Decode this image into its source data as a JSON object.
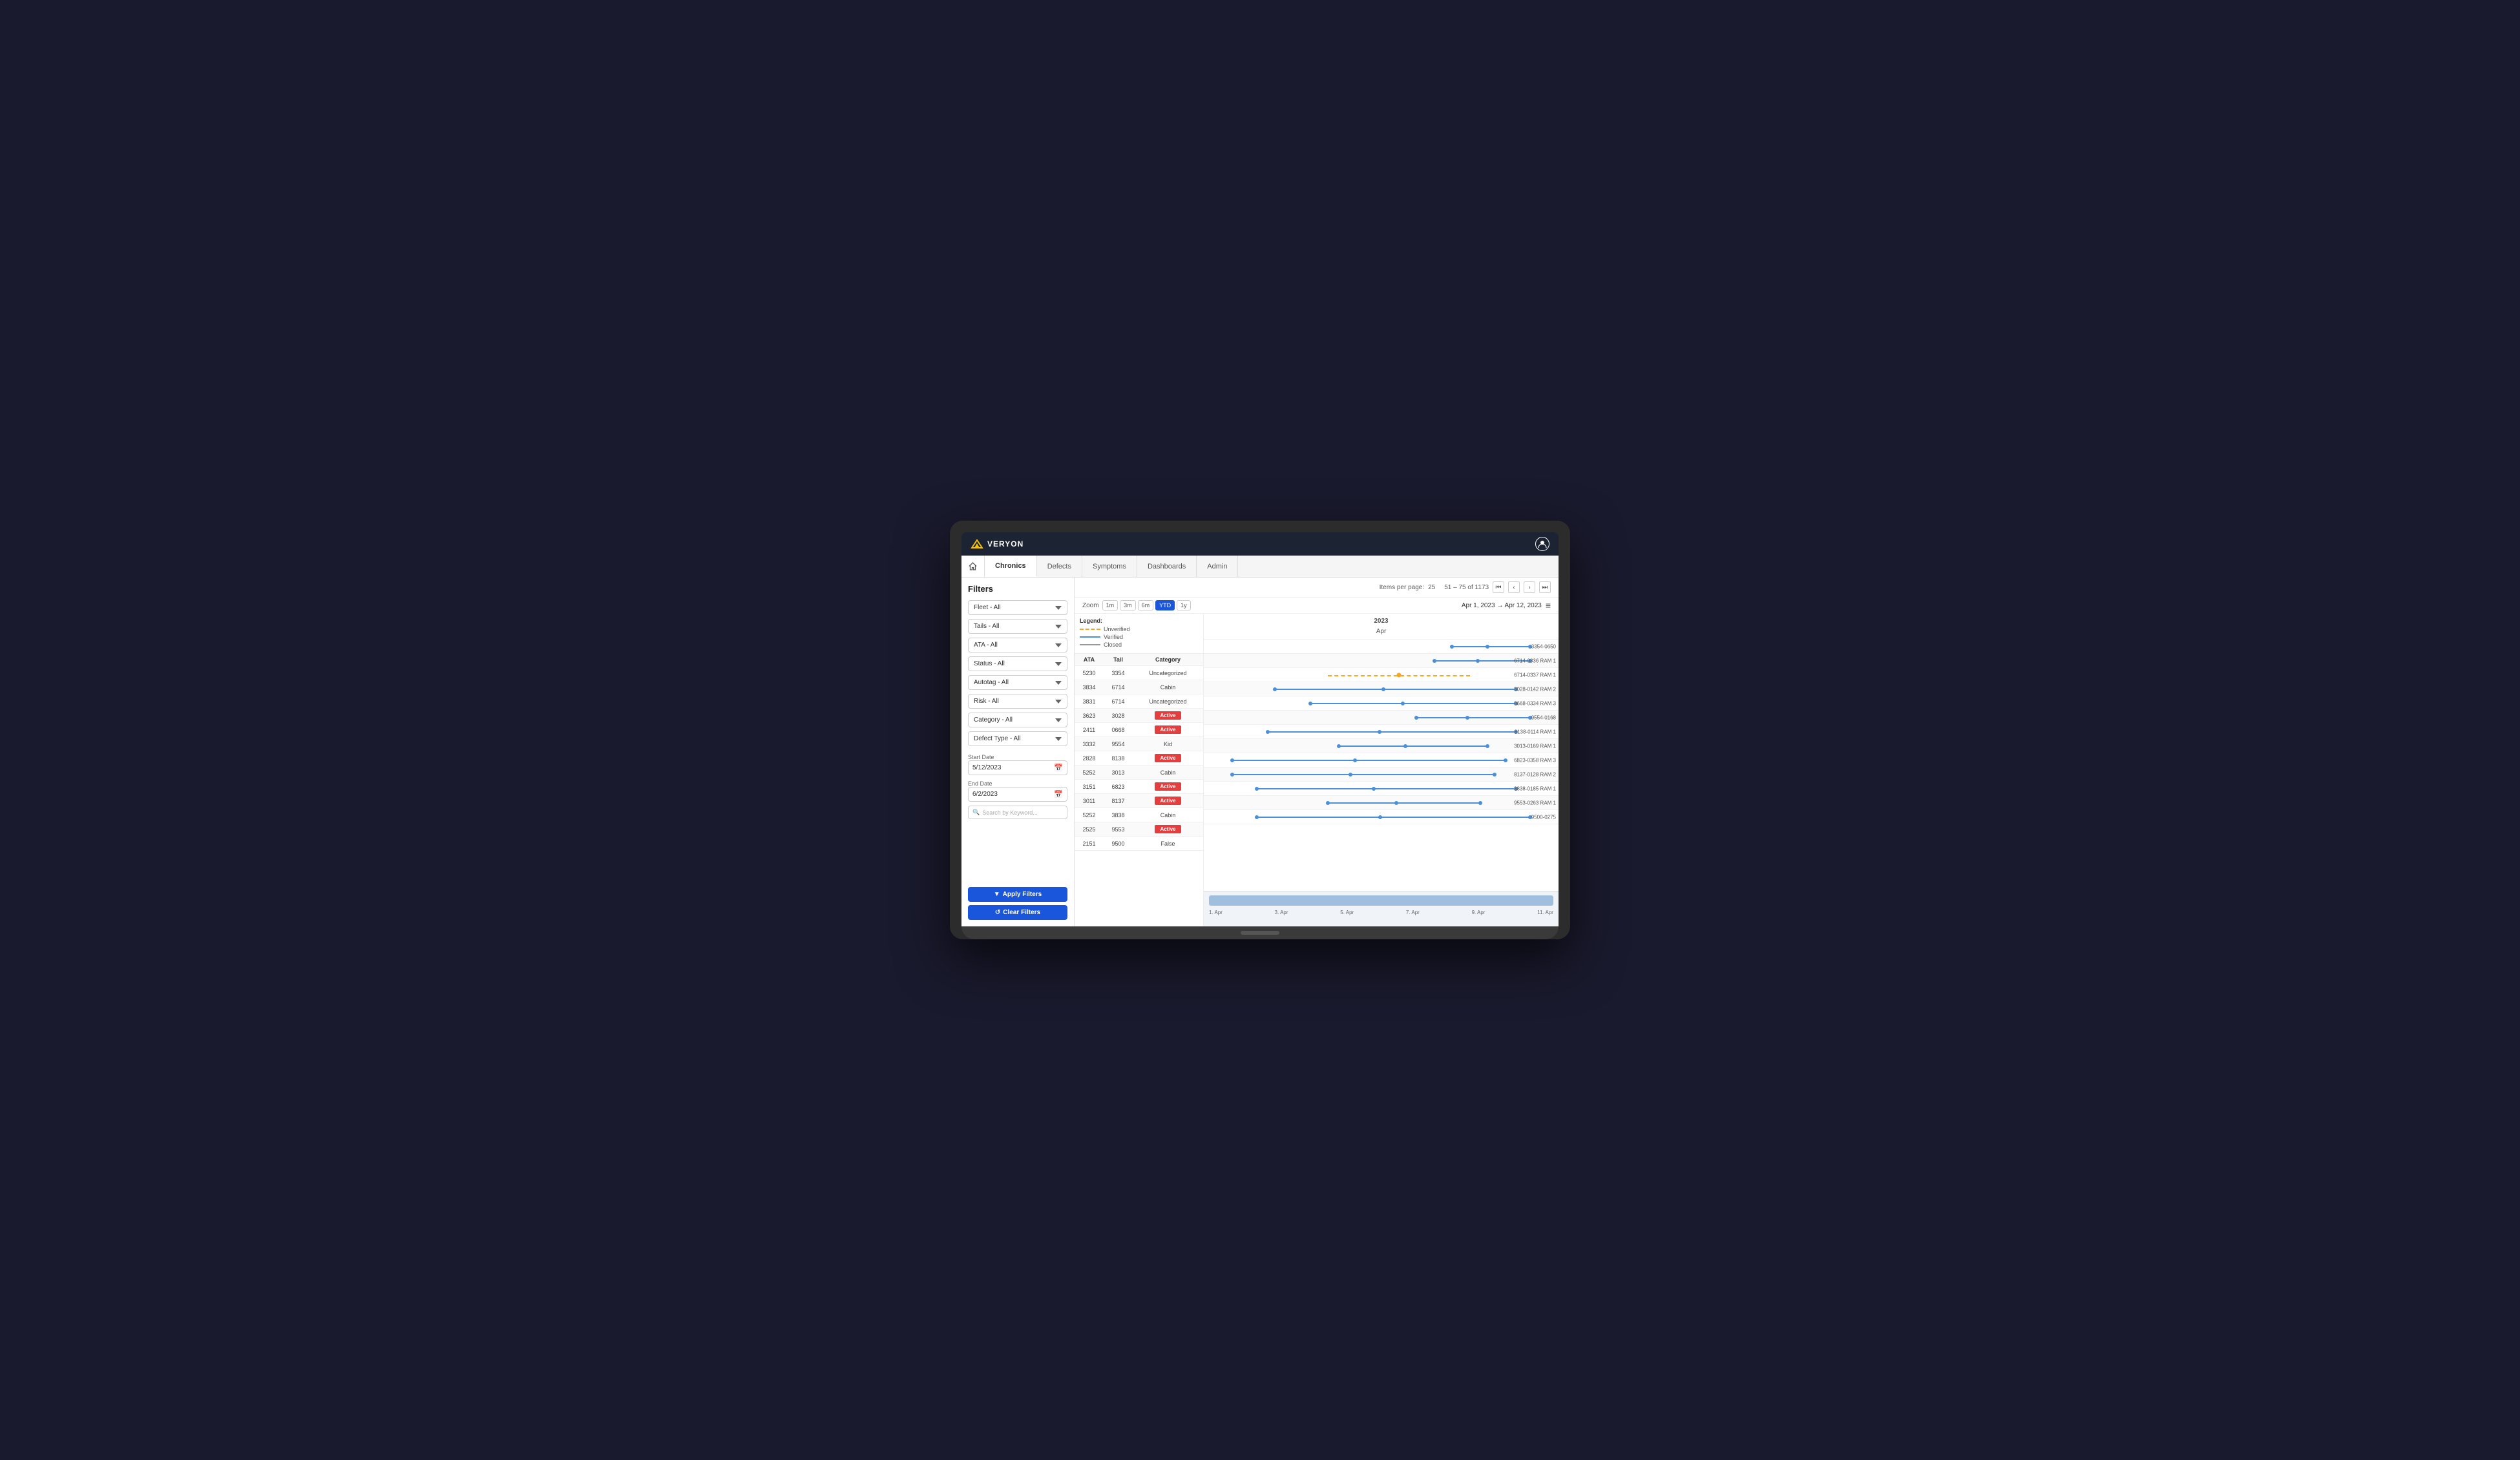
{
  "app": {
    "name": "VERYON",
    "user_icon": "👤"
  },
  "nav": {
    "home_icon": "🏠",
    "tabs": [
      {
        "id": "chronics",
        "label": "Chronics",
        "active": true
      },
      {
        "id": "defects",
        "label": "Defects",
        "active": false
      },
      {
        "id": "symptoms",
        "label": "Symptoms",
        "active": false
      },
      {
        "id": "dashboards",
        "label": "Dashboards",
        "active": false
      },
      {
        "id": "admin",
        "label": "Admin",
        "active": false
      }
    ]
  },
  "sidebar": {
    "title": "Filters",
    "filters": [
      {
        "id": "fleet",
        "label": "Fleet - All"
      },
      {
        "id": "tails",
        "label": "Tails - All"
      },
      {
        "id": "ata",
        "label": "ATA - All"
      },
      {
        "id": "status",
        "label": "Status - All"
      },
      {
        "id": "autotag",
        "label": "Autotag - All"
      },
      {
        "id": "risk",
        "label": "Risk - All"
      },
      {
        "id": "category",
        "label": "Category - All"
      },
      {
        "id": "defect_type",
        "label": "Defect Type - All"
      }
    ],
    "start_date_label": "Start Date",
    "start_date": "5/12/2023",
    "end_date_label": "End Date",
    "end_date": "6/2/2023",
    "search_placeholder": "Search by Keyword...",
    "apply_label": "Apply Filters",
    "clear_label": "Clear Filters"
  },
  "pagination": {
    "items_per_page_label": "Items per page:",
    "items_per_page": "25",
    "range": "51 – 75 of 1173"
  },
  "chart_header": {
    "zoom_label": "Zoom",
    "zoom_buttons": [
      "1m",
      "3m",
      "6m",
      "YTD",
      "1y"
    ],
    "active_zoom": "YTD",
    "date_range": "Apr 1, 2023  →  Apr 12, 2023"
  },
  "legend": {
    "title": "Legend:",
    "items": [
      {
        "label": "Unverified",
        "type": "unverified"
      },
      {
        "label": "Verified",
        "type": "verified"
      },
      {
        "label": "Closed",
        "type": "closed"
      }
    ]
  },
  "table": {
    "headers": [
      "ATA",
      "Tail",
      "Category"
    ],
    "rows": [
      {
        "ata": "5230",
        "tail": "3354",
        "category": "Uncategorized",
        "badge": null,
        "line_type": "verified",
        "line_start": 70,
        "line_end": 92,
        "label": "3354-0650"
      },
      {
        "ata": "3834",
        "tail": "6714",
        "category": "Cabin",
        "badge": null,
        "line_type": "verified",
        "line_start": 65,
        "line_end": 92,
        "label": "6714-0336 RAM 1"
      },
      {
        "ata": "3831",
        "tail": "6714",
        "category": "Uncategorized",
        "badge": null,
        "line_type": "unverified",
        "line_start": 35,
        "line_end": 75,
        "label": "6714-0337 RAM 1"
      },
      {
        "ata": "3623",
        "tail": "3028",
        "category": null,
        "badge": "Active",
        "line_type": "verified",
        "line_start": 20,
        "line_end": 88,
        "label": "3028-0142 RAM 2"
      },
      {
        "ata": "2411",
        "tail": "0668",
        "category": null,
        "badge": "Active",
        "line_type": "verified",
        "line_start": 30,
        "line_end": 88,
        "label": "0668-0334 RAM 3"
      },
      {
        "ata": "3332",
        "tail": "9554",
        "category": "Kid",
        "badge": null,
        "line_type": "verified",
        "line_start": 60,
        "line_end": 92,
        "label": "9554-0168"
      },
      {
        "ata": "2828",
        "tail": "8138",
        "category": null,
        "badge": "Active",
        "line_type": "verified",
        "line_start": 18,
        "line_end": 88,
        "label": "8138-0114 RAM 1"
      },
      {
        "ata": "5252",
        "tail": "3013",
        "category": "Cabin",
        "badge": null,
        "line_type": "verified",
        "line_start": 38,
        "line_end": 80,
        "label": "3013-0169 RAM 1"
      },
      {
        "ata": "3151",
        "tail": "6823",
        "category": null,
        "badge": "Active",
        "line_type": "verified",
        "line_start": 8,
        "line_end": 85,
        "label": "6823-0358 RAM 3"
      },
      {
        "ata": "3011",
        "tail": "8137",
        "category": null,
        "badge": "Active",
        "line_type": "verified",
        "line_start": 8,
        "line_end": 82,
        "label": "8137-0128 RAM 2"
      },
      {
        "ata": "5252",
        "tail": "3838",
        "category": "Cabin",
        "badge": null,
        "line_type": "verified",
        "line_start": 15,
        "line_end": 88,
        "label": "3838-0185 RAM 1"
      },
      {
        "ata": "2525",
        "tail": "9553",
        "category": null,
        "badge": "Active",
        "line_type": "verified",
        "line_start": 35,
        "line_end": 78,
        "label": "9553-0263 RAM 1"
      },
      {
        "ata": "2151",
        "tail": "9500",
        "category": "False",
        "badge": null,
        "line_type": "verified",
        "line_start": 15,
        "line_end": 92,
        "label": "9500-0275"
      }
    ]
  },
  "timeline": {
    "year_label": "2023",
    "month_label": "Apr",
    "scroll_dates": [
      "1. Apr",
      "3. Apr",
      "5. Apr",
      "7. Apr",
      "9. Apr",
      "11. Apr"
    ]
  }
}
